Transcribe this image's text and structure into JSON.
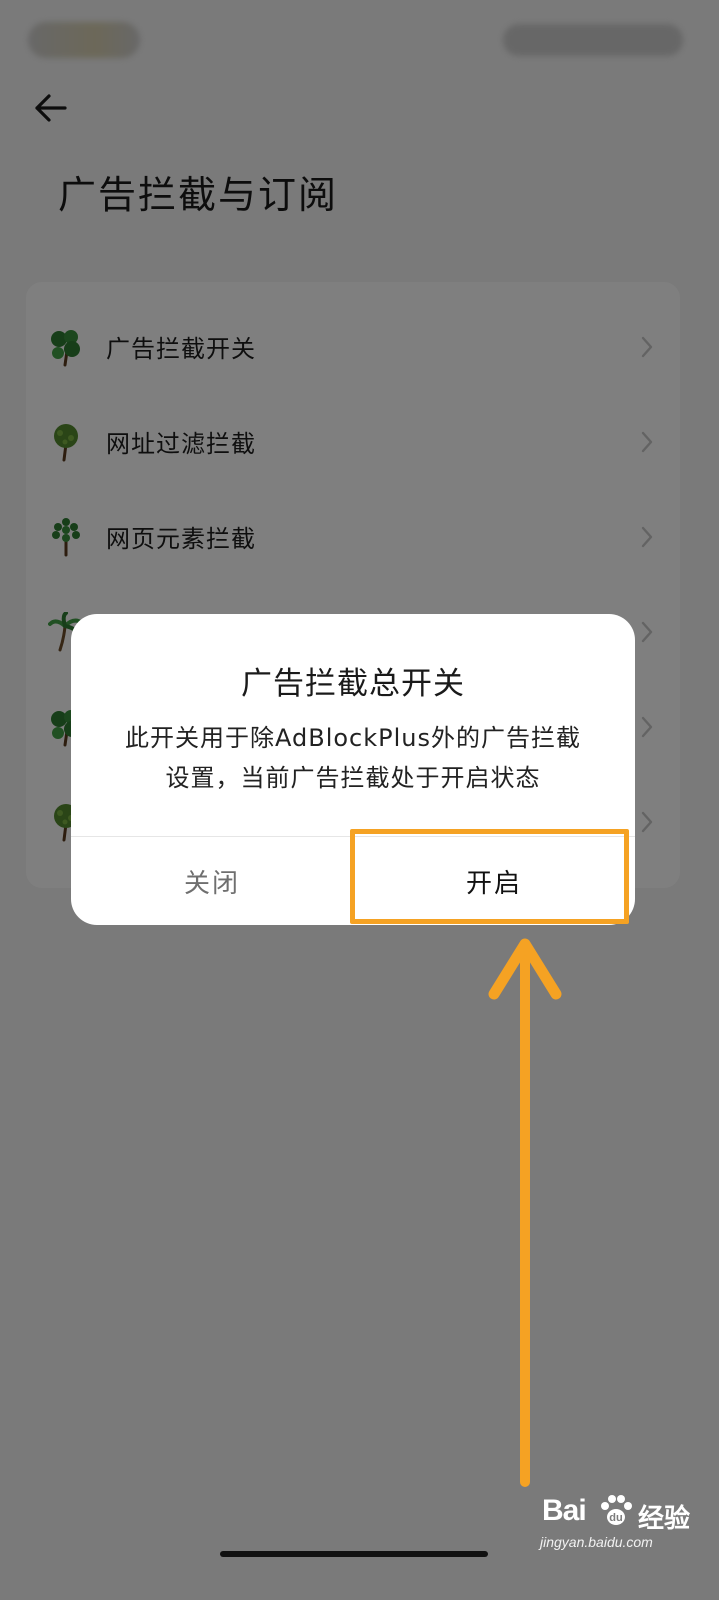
{
  "page": {
    "title": "广告拦截与订阅"
  },
  "settings": {
    "items": [
      {
        "label": "广告拦截开关",
        "icon": "tree-icon"
      },
      {
        "label": "网址过滤拦截",
        "icon": "tree-icon"
      },
      {
        "label": "网页元素拦截",
        "icon": "tree-icon"
      },
      {
        "label": "",
        "icon": "palm-tree-icon"
      },
      {
        "label": "",
        "icon": "tree-icon"
      },
      {
        "label": "",
        "icon": "tree-icon"
      }
    ]
  },
  "dialog": {
    "title": "广告拦截总开关",
    "message": "此开关用于除AdBlockPlus外的广告拦截设置，当前广告拦截处于开启状态",
    "close_label": "关闭",
    "open_label": "开启"
  },
  "annotation": {
    "color": "#f5a223"
  },
  "watermark": {
    "brand": "Bai",
    "brand_suffix": "经验",
    "url": "jingyan.baidu.com"
  },
  "colors": {
    "scrim": "#000000",
    "accent": "#f5a223"
  }
}
